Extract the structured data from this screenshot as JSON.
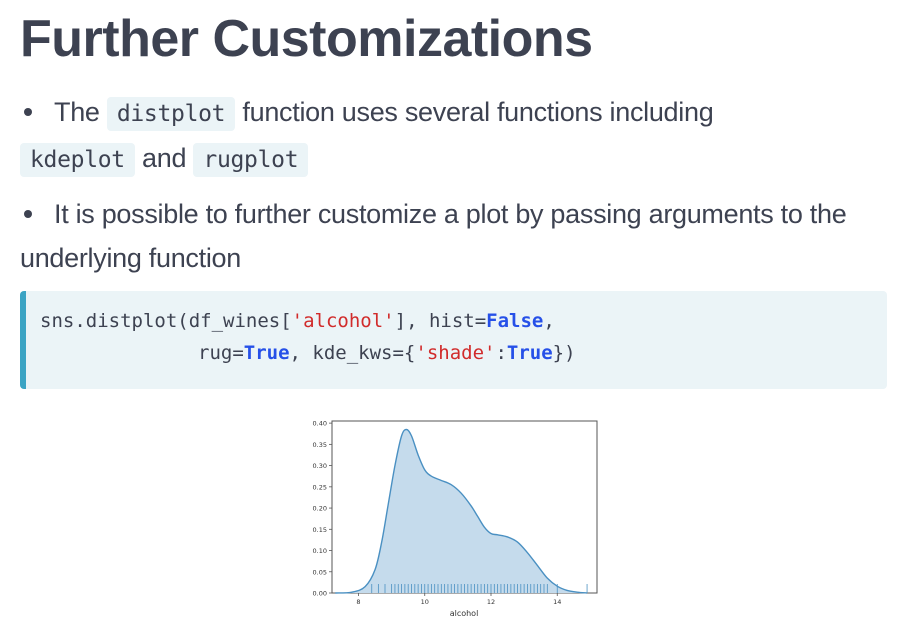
{
  "heading": "Further Customizations",
  "bullets": [
    {
      "text_before": "The",
      "code1": "distplot",
      "text_middle": "function uses several functions including",
      "code2": "kdeplot",
      "text_and": "and",
      "code3": "rugplot"
    },
    {
      "text": "It is possible to further customize a plot by passing arguments to the underlying function"
    }
  ],
  "code": {
    "line1": {
      "a": "sns.distplot(df_wines[",
      "s1": "'alcohol'",
      "b": "], hist=",
      "k1": "False",
      "c": ","
    },
    "line2": {
      "a": "rug=",
      "k1": "True",
      "b": ", kde_kws={",
      "s1": "'shade'",
      "c": ":",
      "k2": "True",
      "d": "})"
    }
  },
  "chart_data": {
    "type": "area",
    "xlabel": "alcohol",
    "ylabel": "",
    "xlim": [
      7.2,
      15.2
    ],
    "ylim": [
      0,
      0.405
    ],
    "xticks": [
      "8",
      "10",
      "12",
      "14"
    ],
    "yticks": [
      "0.00",
      "0.05",
      "0.10",
      "0.15",
      "0.20",
      "0.25",
      "0.30",
      "0.35",
      "0.40"
    ],
    "colors": {
      "line": "#4a90c2",
      "fill": "#c5dbec",
      "rug": "#4a90c2"
    },
    "density": {
      "x": [
        7.3,
        7.8,
        8.2,
        8.5,
        8.7,
        8.9,
        9.1,
        9.3,
        9.45,
        9.6,
        9.8,
        10.0,
        10.2,
        10.5,
        10.8,
        11.1,
        11.4,
        11.6,
        11.8,
        12.0,
        12.2,
        12.5,
        12.8,
        13.1,
        13.4,
        13.7,
        14.0,
        14.3,
        14.6,
        14.9
      ],
      "y": [
        0.0,
        0.002,
        0.015,
        0.055,
        0.12,
        0.21,
        0.3,
        0.37,
        0.385,
        0.37,
        0.325,
        0.29,
        0.275,
        0.265,
        0.255,
        0.235,
        0.205,
        0.18,
        0.155,
        0.14,
        0.137,
        0.132,
        0.12,
        0.095,
        0.065,
        0.035,
        0.016,
        0.006,
        0.002,
        0.0
      ]
    },
    "rug": [
      8.4,
      8.6,
      8.8,
      9.0,
      9.1,
      9.2,
      9.3,
      9.4,
      9.5,
      9.6,
      9.7,
      9.8,
      9.9,
      10.0,
      10.1,
      10.2,
      10.3,
      10.4,
      10.5,
      10.6,
      10.7,
      10.8,
      10.9,
      11.0,
      11.1,
      11.2,
      11.3,
      11.4,
      11.5,
      11.6,
      11.7,
      11.8,
      11.9,
      12.0,
      12.1,
      12.2,
      12.3,
      12.4,
      12.5,
      12.6,
      12.7,
      12.8,
      12.9,
      13.0,
      13.1,
      13.2,
      13.3,
      13.4,
      13.5,
      13.6,
      13.7,
      14.0,
      14.9
    ]
  }
}
